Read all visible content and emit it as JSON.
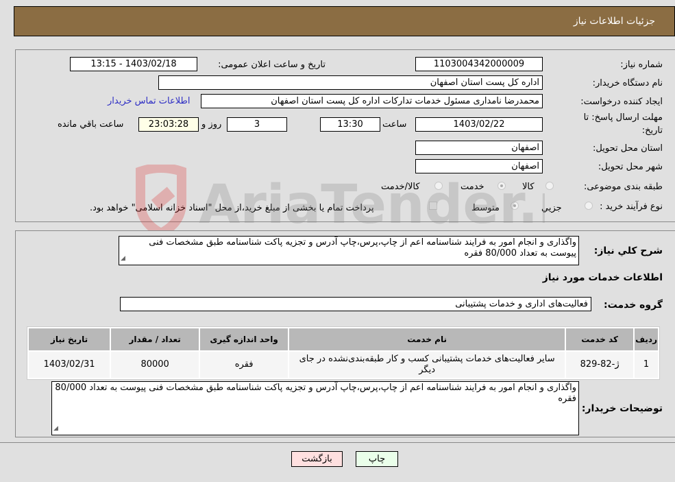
{
  "header": {
    "title": "جزئيات اطلاعات نیاز"
  },
  "form": {
    "need_number_label": "شماره نیاز:",
    "need_number": "1103004342000009",
    "announce_label": "تاریخ و ساعت اعلان عمومی:",
    "announce_value": "1403/02/18 - 13:15",
    "buyer_org_label": "نام دستگاه خریدار:",
    "buyer_org": "اداره کل پست استان اصفهان",
    "creator_label": "ایجاد کننده درخواست:",
    "creator": "محمدرضا نامداری مسئول خدمات تدارکات اداره کل پست استان اصفهان",
    "contact_link": "اطلاعات تماس خریدار",
    "deadline_label_1": "مهلت ارسال پاسخ: تا",
    "deadline_label_2": "تاریخ:",
    "deadline_date": "1403/02/22",
    "time_label": "ساعت",
    "deadline_time": "13:30",
    "days": "3",
    "days_label": "روز و",
    "remaining": "23:03:28",
    "remaining_label": "ساعت باقي مانده",
    "province_label": "استان محل تحویل:",
    "province": "اصفهان",
    "city_label": "شهر محل تحویل:",
    "city": "اصفهان",
    "category_label": "طبقه بندی موضوعی:",
    "category_options": [
      "کالا",
      "خدمت",
      "کالا/خدمت"
    ],
    "category_selected": "خدمت",
    "process_label": "نوع فرآیند خرید :",
    "process_options": [
      "جزيي",
      "متوسط"
    ],
    "process_selected": "متوسط",
    "payment_note": "پرداخت تمام یا بخشی از مبلغ خرید،از محل \"اسناد خزانه اسلامی\" خواهد بود."
  },
  "details": {
    "summary_label": "شرح کلي نیاز:",
    "summary": "واگذاری و انجام امور به فرایند شناسنامه اعم از  چاپ،پرس،چاپ آدرس و تجزیه پاکت شناسنامه طبق مشخصات فنی پیوست به تعداد 80/000 فقره",
    "services_heading": "اطلاعات خدمات مورد نیاز",
    "service_group_label": "گروه خدمت:",
    "service_group": "فعالیت‌های اداری و خدمات پشتیبانی",
    "table": {
      "headers": [
        "ردیف",
        "کد خدمت",
        "نام خدمت",
        "واحد اندازه گیری",
        "تعداد / مقدار",
        "تاریخ نیاز"
      ],
      "rows": [
        [
          "1",
          "ژ-82-829",
          "سایر فعالیت‌های خدمات پشتیبانی کسب و کار طبقه‌بندی‌نشده در جای دیگر",
          "فقره",
          "80000",
          "1403/02/31"
        ]
      ]
    },
    "buyer_notes_label": "توضیحات خریدار:",
    "buyer_notes": "واگذاری و انجام امور به فرایند شناسنامه اعم از  چاپ،پرس،چاپ آدرس و تجزیه پاکت شناسنامه طبق مشخصات فنی پیوست به تعداد 80/000 فقره"
  },
  "buttons": {
    "print": "چاپ",
    "back": "بازگشت"
  },
  "watermark": {
    "text": "AriaTender.neT"
  },
  "colors": {
    "header_bg": "#8b6d43",
    "link": "#2d2dc4",
    "print_bg": "#eaffea",
    "back_bg": "#ffe0e0"
  }
}
